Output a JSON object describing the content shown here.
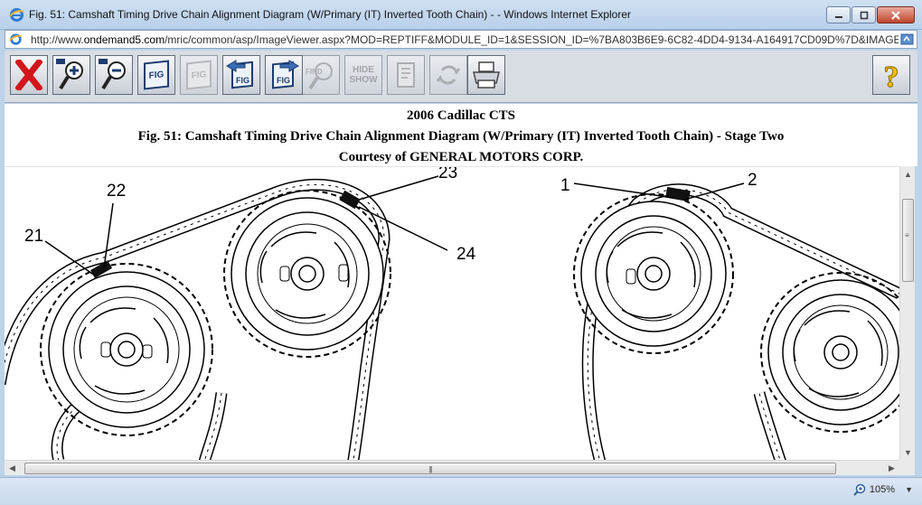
{
  "window": {
    "title": "Fig. 51: Camshaft Timing Drive Chain Alignment Diagram (W/Primary (IT) Inverted Tooth Chain) -  - Windows Internet Explorer",
    "icon": "ie-icon",
    "buttons": [
      "minimize",
      "maximize",
      "close"
    ]
  },
  "address": {
    "url_prefix": "http://www.",
    "url_domain": "ondemand5.com",
    "url_rest": "/mric/common/asp/ImageViewer.aspx?MOD=REPTIFF&MODULE_ID=1&SESSION_ID=%7BA803B6E9-6C82-4DD4-9134-A164917CD09D%7D&IMAGE_GUI"
  },
  "toolbar": {
    "buttons": [
      {
        "name": "close-x",
        "icon": "red-x-icon",
        "enabled": true
      },
      {
        "name": "zoom-in",
        "icon": "zoom-in-icon",
        "enabled": true
      },
      {
        "name": "zoom-out",
        "icon": "zoom-out-icon",
        "enabled": true
      },
      {
        "name": "fig-window",
        "icon": "fig-window-icon",
        "enabled": true
      },
      {
        "name": "fig-hand",
        "icon": "fig-hand-icon",
        "enabled": false
      },
      {
        "name": "fig-prev",
        "icon": "fig-prev-icon",
        "enabled": true
      },
      {
        "name": "fig-next",
        "icon": "fig-next-icon",
        "enabled": true
      },
      {
        "name": "find",
        "label": "FIND",
        "enabled": false
      },
      {
        "name": "hide-show",
        "label": "HIDE SHOW",
        "enabled": false
      },
      {
        "name": "notes",
        "icon": "notes-icon",
        "enabled": false
      },
      {
        "name": "refresh",
        "icon": "refresh-icon",
        "enabled": false
      },
      {
        "name": "print",
        "icon": "printer-icon",
        "enabled": true
      },
      {
        "name": "help",
        "label": "?",
        "enabled": true
      }
    ],
    "fig_text": "FIG",
    "find_label": "FIND",
    "hide_label": "HIDE",
    "show_label": "SHOW",
    "help_label": "?"
  },
  "header": {
    "line1": "2006 Cadillac CTS",
    "line2": "Fig. 51: Camshaft Timing Drive Chain Alignment Diagram (W/Primary (IT) Inverted Tooth Chain) - Stage Two",
    "line3": "Courtesy of GENERAL MOTORS CORP."
  },
  "diagram": {
    "callouts": [
      "22",
      "21",
      "23",
      "24",
      "1",
      "2"
    ]
  },
  "status": {
    "zoom": "105%"
  },
  "colors": {
    "accent": "#1d3c6e",
    "close_red": "#c0452d"
  }
}
